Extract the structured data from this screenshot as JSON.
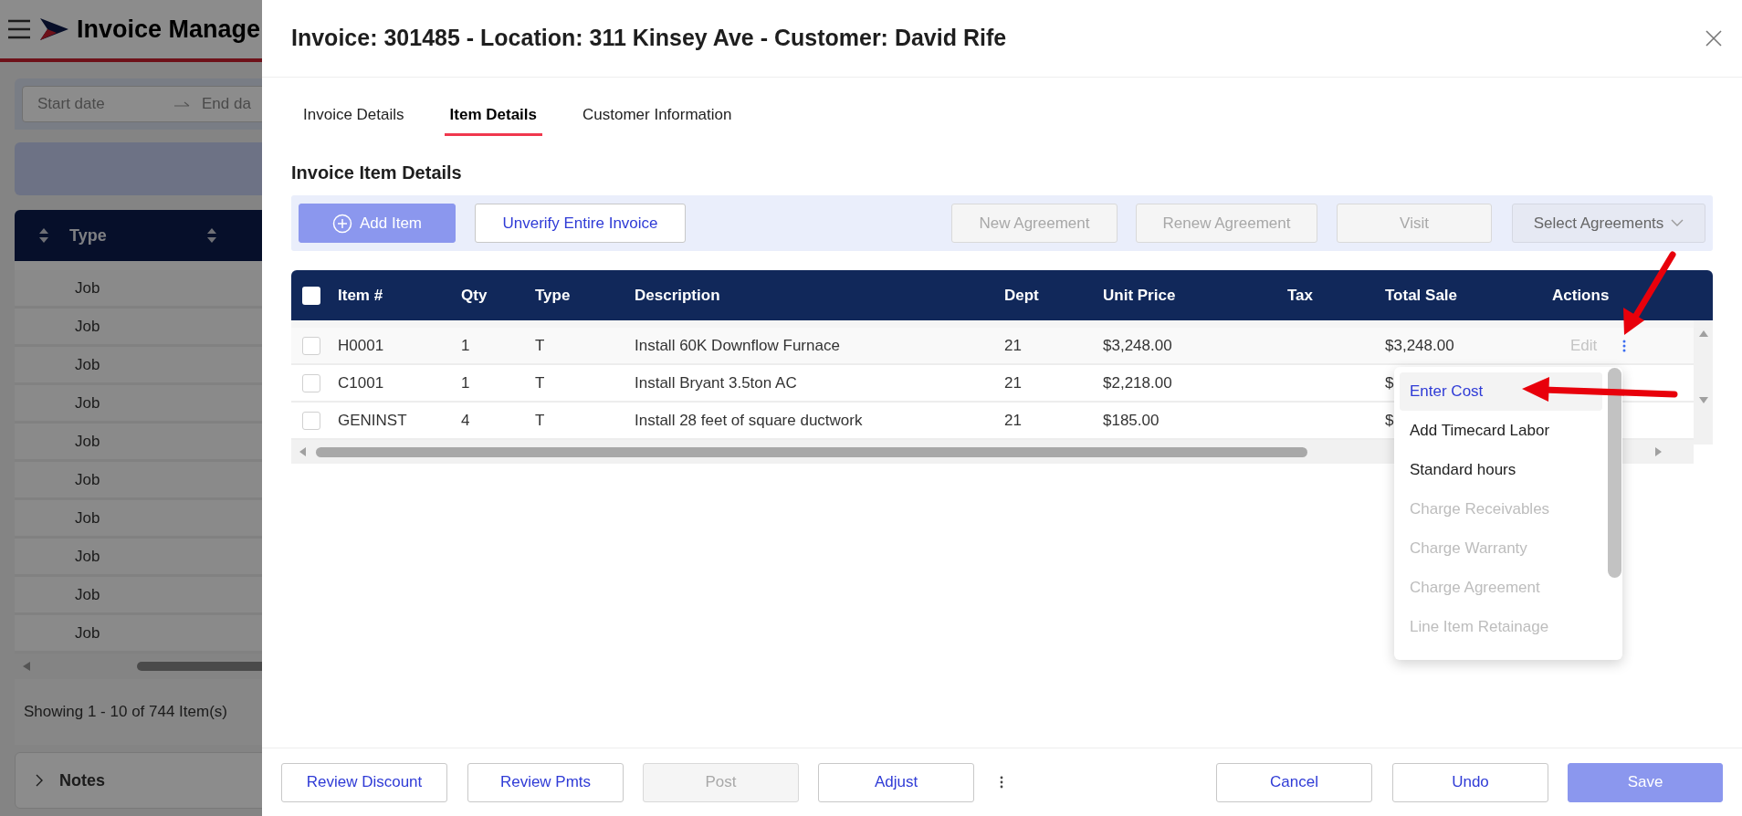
{
  "background": {
    "app_title": "Invoice Manage",
    "date_range": {
      "start_placeholder": "Start date",
      "end_placeholder": "End da"
    },
    "table": {
      "columns": [
        "Type"
      ],
      "rows": [
        "Job",
        "Job",
        "Job",
        "Job",
        "Job",
        "Job",
        "Job",
        "Job",
        "Job",
        "Job"
      ]
    },
    "pagination_text": "Showing 1 - 10 of 744 Item(s)",
    "notes_label": "Notes"
  },
  "modal": {
    "title": "Invoice: 301485 - Location: 311 Kinsey Ave - Customer: David Rife",
    "tabs": [
      {
        "label": "Invoice Details",
        "selected": false
      },
      {
        "label": "Item Details",
        "selected": true
      },
      {
        "label": "Customer Information",
        "selected": false
      }
    ],
    "section_title": "Invoice Item Details",
    "toolbar": [
      {
        "label": "Add Item",
        "kind": "primary",
        "disabled": false
      },
      {
        "label": "Unverify Entire Invoice",
        "kind": "outline",
        "disabled": false
      },
      {
        "label": "New Agreement",
        "kind": "outline",
        "disabled": true
      },
      {
        "label": "Renew Agreement",
        "kind": "outline",
        "disabled": true
      },
      {
        "label": "Visit",
        "kind": "outline",
        "disabled": true
      },
      {
        "label": "Select Agreements",
        "kind": "select",
        "disabled": true
      }
    ],
    "table": {
      "header_checked": false,
      "columns": [
        "Item #",
        "Qty",
        "Type",
        "Description",
        "Dept",
        "Unit Price",
        "Tax",
        "Total Sale",
        "Actions"
      ],
      "rows": [
        {
          "checked": false,
          "item": "H0001",
          "qty": "1",
          "type": "T",
          "description": "Install 60K Downflow Furnace",
          "dept": "21",
          "unit_price": "$3,248.00",
          "total_sale": "$3,248.00",
          "action": {
            "label": "Edit",
            "disabled": true
          }
        },
        {
          "checked": false,
          "item": "C1001",
          "qty": "1",
          "type": "T",
          "description": "Install Bryant 3.5ton AC",
          "dept": "21",
          "unit_price": "$2,218.00",
          "total_sale": "$"
        },
        {
          "checked": false,
          "item": "GENINST",
          "qty": "4",
          "type": "T",
          "description": "Install 28 feet of square ductwork",
          "dept": "21",
          "unit_price": "$185.00",
          "total_sale": "$"
        }
      ]
    },
    "action_menu": [
      {
        "label": "Enter Cost",
        "selected": true,
        "disabled": false
      },
      {
        "label": "Add Timecard Labor",
        "selected": false,
        "disabled": false
      },
      {
        "label": "Standard hours",
        "selected": false,
        "disabled": false
      },
      {
        "label": "Charge Receivables",
        "selected": false,
        "disabled": true
      },
      {
        "label": "Charge Warranty",
        "selected": false,
        "disabled": true
      },
      {
        "label": "Charge Agreement",
        "selected": false,
        "disabled": true
      },
      {
        "label": "Line Item Retainage",
        "selected": false,
        "disabled": true
      }
    ],
    "footer_left": [
      {
        "label": "Review Discount",
        "kind": "outline",
        "disabled": false
      },
      {
        "label": "Review Pmts",
        "kind": "outline",
        "disabled": false
      },
      {
        "label": "Post",
        "kind": "outline",
        "disabled": true
      },
      {
        "label": "Adjust",
        "kind": "outline",
        "disabled": false
      }
    ],
    "footer_right": [
      {
        "label": "Cancel",
        "kind": "outline",
        "disabled": false
      },
      {
        "label": "Undo",
        "kind": "outline",
        "disabled": false
      },
      {
        "label": "Save",
        "kind": "primary",
        "disabled": false
      }
    ]
  }
}
